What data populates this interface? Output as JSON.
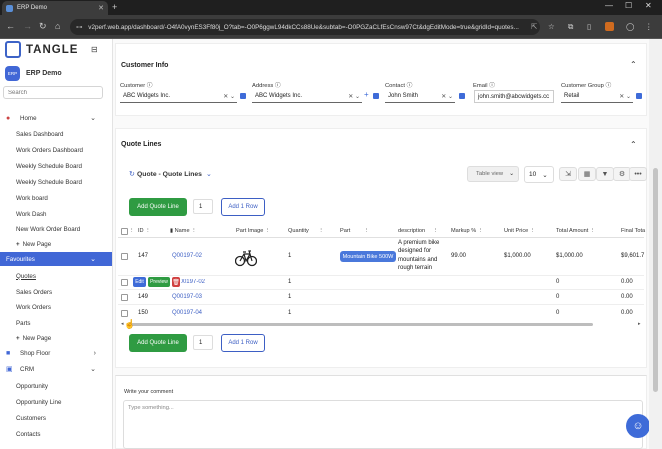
{
  "browser": {
    "tab_title": "ERP Demo",
    "url": "v2perf.web.app/dashboard/-O4fA0vynES3Ff80j_O?tab=-O0P6ggwL94dkCCs88Ue&subtab=-O0PGZaCLfEsCnsw97Ct&dgEditMode=true&gridId=quotes..."
  },
  "sidebar": {
    "logo_text": "TANGLE",
    "org_badge": "ERP",
    "org_name": "ERP Demo",
    "search_placeholder": "Search",
    "items": [
      {
        "label": "Home"
      },
      {
        "label": "Sales Dashboard"
      },
      {
        "label": "Work Orders Dashboard"
      },
      {
        "label": "Weekly Schedule Board"
      },
      {
        "label": "Weekly Schedule Board"
      },
      {
        "label": "Work board"
      },
      {
        "label": "Work Dash"
      },
      {
        "label": "New Work Order Board"
      },
      {
        "label": "New Page"
      },
      {
        "label": "Favourites"
      },
      {
        "label": "Quotes"
      },
      {
        "label": "Sales Orders"
      },
      {
        "label": "Work Orders"
      },
      {
        "label": "Parts"
      },
      {
        "label": "New Page"
      },
      {
        "label": "Shop Floor"
      },
      {
        "label": "CRM"
      },
      {
        "label": "Opportunity"
      },
      {
        "label": "Opportunity Line"
      },
      {
        "label": "Customers"
      },
      {
        "label": "Contacts"
      }
    ]
  },
  "customer_info": {
    "title": "Customer Info",
    "fields": [
      {
        "label": "Customer",
        "value": "ABC Widgets Inc."
      },
      {
        "label": "Address",
        "value": "ABC Widgets Inc."
      },
      {
        "label": "Contact",
        "value": "John Smith"
      },
      {
        "label": "Email",
        "value": "john.smith@abcwidgets.cc"
      },
      {
        "label": "Customer Group",
        "value": "Retail"
      }
    ]
  },
  "quote_lines": {
    "title": "Quote Lines",
    "grid_title": "Quote - Quote Lines",
    "view_select": "Table view",
    "page_size": "10",
    "add_button": "Add Quote Line",
    "qty": "1",
    "add_row_button": "Add 1 Row",
    "columns": [
      "ID",
      "Name",
      "Part Image",
      "Quantity",
      "Part",
      "description",
      "Markup %",
      "Unit Price",
      "Total Amount",
      "Final Tota"
    ],
    "rows": [
      {
        "id": "147",
        "name": "Q00197-02",
        "quantity": "1",
        "part": "Mountain Bike 500W",
        "description": "A premium bike designed for mountains and rough terrain",
        "markup": "99.00",
        "unit_price": "$1,000.00",
        "total": "$1,000.00",
        "final": "$9,601.7"
      },
      {
        "id": "148",
        "name": "Q00197-02",
        "quantity": "1",
        "part": "",
        "description": "",
        "markup": "",
        "unit_price": "",
        "total": "0",
        "final": "0.00"
      },
      {
        "id": "149",
        "name": "Q00197-03",
        "quantity": "1",
        "part": "",
        "description": "",
        "markup": "",
        "unit_price": "",
        "total": "0",
        "final": "0.00"
      },
      {
        "id": "150",
        "name": "Q00197-04",
        "quantity": "1",
        "part": "",
        "description": "",
        "markup": "",
        "unit_price": "",
        "total": "0",
        "final": "0.00"
      }
    ],
    "row_actions": {
      "edit": "Edit",
      "preview": "Preview"
    }
  },
  "comment": {
    "label": "Write your comment",
    "placeholder": "Type something..."
  },
  "colors": {
    "accent": "#4167d6",
    "green": "#2f9b42",
    "link": "#3d5fc4"
  }
}
